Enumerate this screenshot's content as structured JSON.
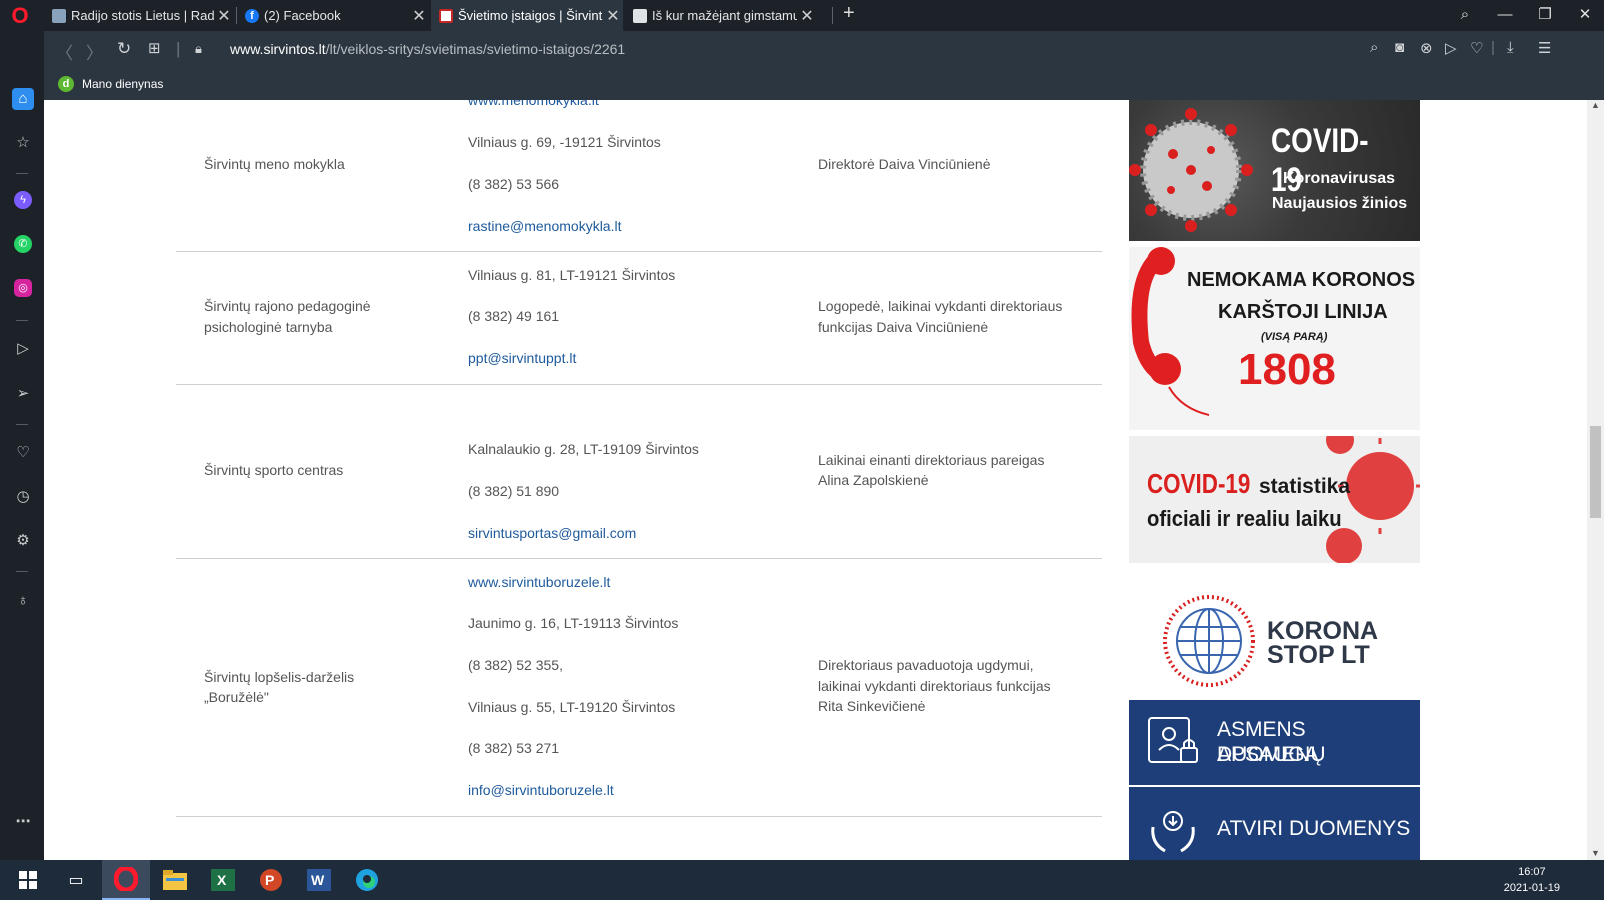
{
  "browser": {
    "tabs": [
      {
        "title": "Radijo stotis Lietus | Radijo",
        "icon": "radio-favicon"
      },
      {
        "title": "(2) Facebook",
        "icon": "facebook-favicon"
      },
      {
        "title": "Švietimo įstaigos | Širvintų r",
        "icon": "sirvintos-favicon"
      },
      {
        "title": "Iš kur mažėjant gimstamum",
        "icon": "document-favicon"
      }
    ],
    "active_tab": 2,
    "url_domain": "www.sirvintos.lt",
    "url_path": "/lt/veiklos-sritys/svietimas/svietimo-istaigos/2261",
    "bookmark": "Mano dienynas"
  },
  "institutions": [
    {
      "name_line1": "Širvintų meno mokykla",
      "name_line2": "",
      "web": "www.menomokykla.lt",
      "address": "Vilniaus g. 69, -19121 Širvintos",
      "phone": "(8 382) 53 566",
      "email": "rastine@menomokykla.lt",
      "head_line1": "Direktorė Daiva Vinciūnienė",
      "head_line2": "",
      "head_line3": ""
    },
    {
      "name_line1": "Širvintų rajono pedagoginė",
      "name_line2": "psichologinė tarnyba",
      "address": "Vilniaus g. 81, LT-19121 Širvintos",
      "phone": "(8 382) 49 161",
      "email": "ppt@sirvintuppt.lt",
      "head_line1": "Logopedė, laikinai vykdanti direktoriaus",
      "head_line2": "funkcijas Daiva Vinciūnienė",
      "head_line3": ""
    },
    {
      "name_line1": "Širvintų sporto centras",
      "name_line2": "",
      "address": "Kalnalaukio g. 28, LT-19109 Širvintos",
      "phone": "(8 382) 51 890",
      "email": "sirvintusportas@gmail.com",
      "head_line1": "Laikinai einanti direktoriaus pareigas",
      "head_line2": "Alina Zapolskienė",
      "head_line3": ""
    },
    {
      "name_line1": "Širvintų lopšelis-darželis",
      "name_line2": "„Boružėlė\"",
      "web": "www.sirvintuboruzele.lt",
      "address": "Jaunimo g. 16, LT-19113 Širvintos",
      "phone": "(8 382) 52 355,",
      "address2": "Vilniaus g. 55, LT-19120 Širvintos",
      "phone2": "(8 382) 53 271",
      "email": "info@sirvintuboruzele.lt",
      "head_line1": "Direktoriaus pavaduotoja ugdymui,",
      "head_line2": "laikinai vykdanti direktoriaus funkcijas",
      "head_line3": "Rita Sinkevičienė"
    }
  ],
  "banners": {
    "covid": {
      "title": "COVID-19",
      "line1": "Koronavirusas",
      "line2": "Naujausios žinios"
    },
    "hotline": {
      "line1": "NEMOKAMA KORONOS",
      "line2": "KARŠTOJI LINIJA",
      "line3": "(VISĄ PARĄ)",
      "number": "1808"
    },
    "stats": {
      "red": "COVID-19",
      "dark": "statistika",
      "line2": "oficiali ir realiu laiku"
    },
    "korona": {
      "line1": "KORONA",
      "line2": "STOP LT"
    },
    "privacy": {
      "line1": "ASMENS DUOMENŲ",
      "line2": "APSAUGA"
    },
    "opendata": {
      "line1": "ATVIRI DUOMENYS"
    }
  },
  "taskbar": {
    "time": "16:07",
    "date": "2021-01-19"
  },
  "colors": {
    "link": "#1e5a9c",
    "banner_blue": "#1d3e78",
    "covid_red": "#d9201f"
  }
}
